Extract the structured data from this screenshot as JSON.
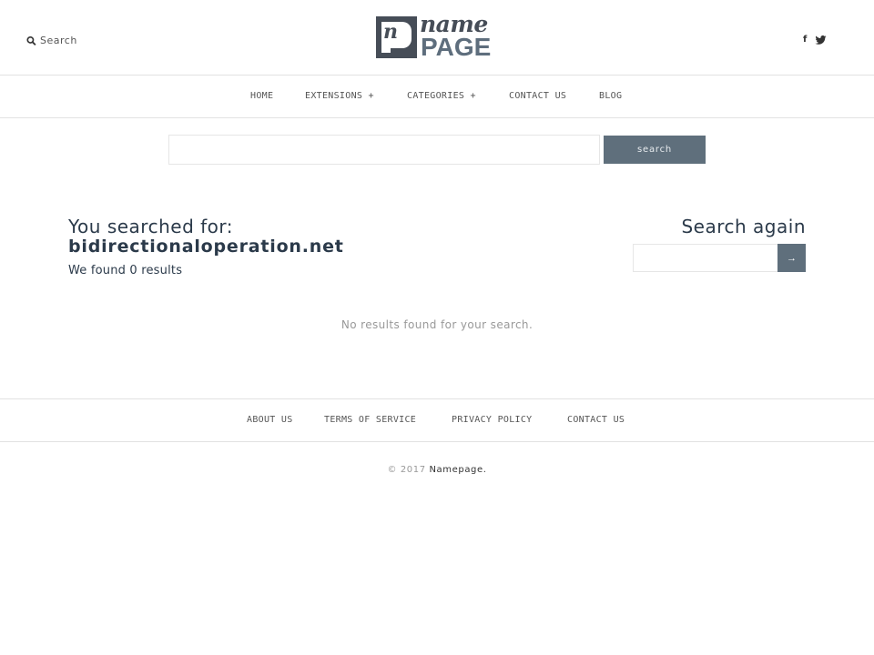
{
  "header": {
    "search_label": "Search",
    "search_icon": "magnifier-icon",
    "logo": {
      "mark_letter": "n",
      "name": "name",
      "page": "PAGE"
    },
    "social": [
      {
        "icon": "facebook-icon",
        "glyph": "f"
      },
      {
        "icon": "twitter-icon",
        "glyph": "🐦"
      }
    ]
  },
  "nav": {
    "items": [
      {
        "label": "HOME"
      },
      {
        "label": "EXTENSIONS +"
      },
      {
        "label": "CATEGORIES +"
      },
      {
        "label": "CONTACT US"
      },
      {
        "label": "BLOG"
      }
    ]
  },
  "top_search": {
    "value": "",
    "placeholder": "",
    "button_label": "search"
  },
  "results": {
    "heading": "You searched for:",
    "query": "bidirectionaloperation.net",
    "count_text": "We found 0 results",
    "empty_message": "No results found for your search."
  },
  "search_again": {
    "title": "Search again",
    "value": "",
    "button_label": "→"
  },
  "footer": {
    "links": [
      {
        "label": "ABOUT US"
      },
      {
        "label": "TERMS OF SERVICE"
      },
      {
        "label": "PRIVACY POLICY"
      },
      {
        "label": "CONTACT US"
      }
    ],
    "copyright_prefix": "© 2017",
    "copyright_brand": "Namepage."
  },
  "colors": {
    "accent": "#5f6f7c",
    "text": "#2b3a4a",
    "logo_dark": "#464d57"
  }
}
